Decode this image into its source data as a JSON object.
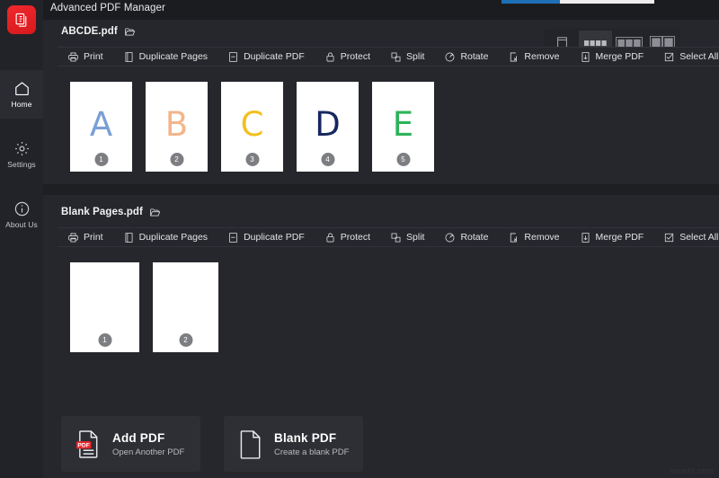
{
  "app": {
    "title": "Advanced PDF Manager",
    "logo_icon": "pdf-copy-icon",
    "watermark": "wsxdn.com"
  },
  "progress": {
    "value": 38,
    "fill_color": "#1f6fb5",
    "track_color": "#f0eeec"
  },
  "sidebar": {
    "items": [
      {
        "label": "Home",
        "icon": "home-icon",
        "active": true
      },
      {
        "label": "Settings",
        "icon": "gear-icon",
        "active": false
      },
      {
        "label": "About Us",
        "icon": "info-icon",
        "active": false
      }
    ]
  },
  "view_toggle": {
    "options": [
      {
        "icon": "single-page-view-icon",
        "active": false
      },
      {
        "icon": "list-view-icon",
        "active": true
      },
      {
        "icon": "three-column-view-icon",
        "active": false
      },
      {
        "icon": "two-column-view-icon",
        "active": false
      }
    ]
  },
  "action_labels": [
    {
      "label": "Print",
      "icon": "printer-icon"
    },
    {
      "label": "Duplicate Pages",
      "icon": "duplicate-pages-icon"
    },
    {
      "label": "Duplicate PDF",
      "icon": "duplicate-pdf-icon"
    },
    {
      "label": "Protect",
      "icon": "lock-icon"
    },
    {
      "label": "Split",
      "icon": "split-icon"
    },
    {
      "label": "Rotate",
      "icon": "rotate-icon"
    },
    {
      "label": "Remove",
      "icon": "remove-icon"
    },
    {
      "label": "Merge PDF",
      "icon": "merge-pdf-icon"
    },
    {
      "label": "Select All",
      "icon": "checkbox-check-icon"
    }
  ],
  "files": [
    {
      "name": "ABCDE.pdf",
      "folder_icon": "open-folder-icon",
      "pages": [
        {
          "number": "1",
          "letter": "A",
          "color": "#7a9fd4"
        },
        {
          "number": "2",
          "letter": "B",
          "color": "#f2b58c"
        },
        {
          "number": "3",
          "letter": "C",
          "color": "#f2c020"
        },
        {
          "number": "4",
          "letter": "D",
          "color": "#17275e"
        },
        {
          "number": "5",
          "letter": "E",
          "color": "#2eb35a"
        }
      ]
    },
    {
      "name": "Blank Pages.pdf",
      "folder_icon": "open-folder-icon",
      "pages": [
        {
          "number": "1",
          "letter": "",
          "color": ""
        },
        {
          "number": "2",
          "letter": "",
          "color": ""
        }
      ]
    }
  ],
  "bottom_buttons": [
    {
      "title": "Add PDF",
      "subtitle": "Open Another PDF",
      "icon": "pdf-file-icon"
    },
    {
      "title": "Blank PDF",
      "subtitle": "Create a blank PDF",
      "icon": "blank-file-icon"
    }
  ]
}
